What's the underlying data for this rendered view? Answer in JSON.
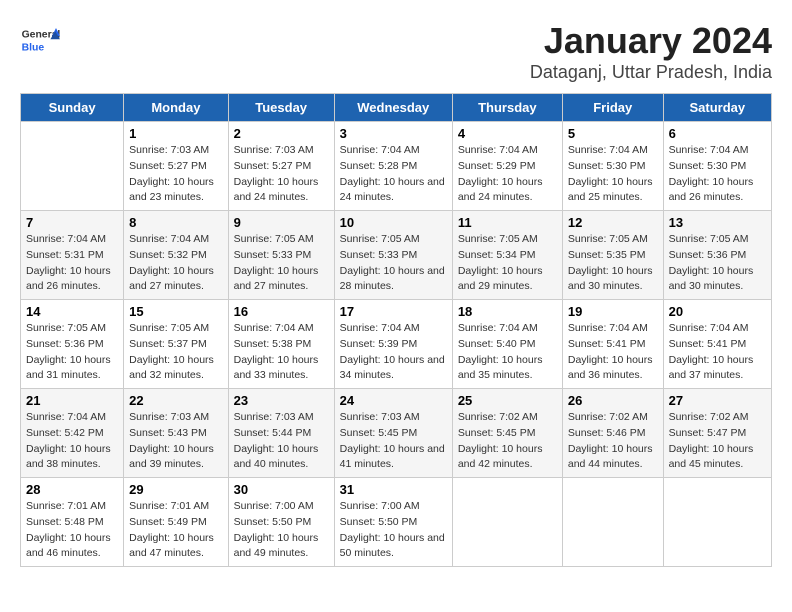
{
  "header": {
    "logo_general": "General",
    "logo_blue": "Blue",
    "title": "January 2024",
    "subtitle": "Dataganj, Uttar Pradesh, India"
  },
  "columns": [
    "Sunday",
    "Monday",
    "Tuesday",
    "Wednesday",
    "Thursday",
    "Friday",
    "Saturday"
  ],
  "weeks": [
    [
      {
        "num": "",
        "sunrise": "",
        "sunset": "",
        "daylight": ""
      },
      {
        "num": "1",
        "sunrise": "7:03 AM",
        "sunset": "5:27 PM",
        "daylight": "10 hours and 23 minutes."
      },
      {
        "num": "2",
        "sunrise": "7:03 AM",
        "sunset": "5:27 PM",
        "daylight": "10 hours and 24 minutes."
      },
      {
        "num": "3",
        "sunrise": "7:04 AM",
        "sunset": "5:28 PM",
        "daylight": "10 hours and 24 minutes."
      },
      {
        "num": "4",
        "sunrise": "7:04 AM",
        "sunset": "5:29 PM",
        "daylight": "10 hours and 24 minutes."
      },
      {
        "num": "5",
        "sunrise": "7:04 AM",
        "sunset": "5:30 PM",
        "daylight": "10 hours and 25 minutes."
      },
      {
        "num": "6",
        "sunrise": "7:04 AM",
        "sunset": "5:30 PM",
        "daylight": "10 hours and 26 minutes."
      }
    ],
    [
      {
        "num": "7",
        "sunrise": "7:04 AM",
        "sunset": "5:31 PM",
        "daylight": "10 hours and 26 minutes."
      },
      {
        "num": "8",
        "sunrise": "7:04 AM",
        "sunset": "5:32 PM",
        "daylight": "10 hours and 27 minutes."
      },
      {
        "num": "9",
        "sunrise": "7:05 AM",
        "sunset": "5:33 PM",
        "daylight": "10 hours and 27 minutes."
      },
      {
        "num": "10",
        "sunrise": "7:05 AM",
        "sunset": "5:33 PM",
        "daylight": "10 hours and 28 minutes."
      },
      {
        "num": "11",
        "sunrise": "7:05 AM",
        "sunset": "5:34 PM",
        "daylight": "10 hours and 29 minutes."
      },
      {
        "num": "12",
        "sunrise": "7:05 AM",
        "sunset": "5:35 PM",
        "daylight": "10 hours and 30 minutes."
      },
      {
        "num": "13",
        "sunrise": "7:05 AM",
        "sunset": "5:36 PM",
        "daylight": "10 hours and 30 minutes."
      }
    ],
    [
      {
        "num": "14",
        "sunrise": "7:05 AM",
        "sunset": "5:36 PM",
        "daylight": "10 hours and 31 minutes."
      },
      {
        "num": "15",
        "sunrise": "7:05 AM",
        "sunset": "5:37 PM",
        "daylight": "10 hours and 32 minutes."
      },
      {
        "num": "16",
        "sunrise": "7:04 AM",
        "sunset": "5:38 PM",
        "daylight": "10 hours and 33 minutes."
      },
      {
        "num": "17",
        "sunrise": "7:04 AM",
        "sunset": "5:39 PM",
        "daylight": "10 hours and 34 minutes."
      },
      {
        "num": "18",
        "sunrise": "7:04 AM",
        "sunset": "5:40 PM",
        "daylight": "10 hours and 35 minutes."
      },
      {
        "num": "19",
        "sunrise": "7:04 AM",
        "sunset": "5:41 PM",
        "daylight": "10 hours and 36 minutes."
      },
      {
        "num": "20",
        "sunrise": "7:04 AM",
        "sunset": "5:41 PM",
        "daylight": "10 hours and 37 minutes."
      }
    ],
    [
      {
        "num": "21",
        "sunrise": "7:04 AM",
        "sunset": "5:42 PM",
        "daylight": "10 hours and 38 minutes."
      },
      {
        "num": "22",
        "sunrise": "7:03 AM",
        "sunset": "5:43 PM",
        "daylight": "10 hours and 39 minutes."
      },
      {
        "num": "23",
        "sunrise": "7:03 AM",
        "sunset": "5:44 PM",
        "daylight": "10 hours and 40 minutes."
      },
      {
        "num": "24",
        "sunrise": "7:03 AM",
        "sunset": "5:45 PM",
        "daylight": "10 hours and 41 minutes."
      },
      {
        "num": "25",
        "sunrise": "7:02 AM",
        "sunset": "5:45 PM",
        "daylight": "10 hours and 42 minutes."
      },
      {
        "num": "26",
        "sunrise": "7:02 AM",
        "sunset": "5:46 PM",
        "daylight": "10 hours and 44 minutes."
      },
      {
        "num": "27",
        "sunrise": "7:02 AM",
        "sunset": "5:47 PM",
        "daylight": "10 hours and 45 minutes."
      }
    ],
    [
      {
        "num": "28",
        "sunrise": "7:01 AM",
        "sunset": "5:48 PM",
        "daylight": "10 hours and 46 minutes."
      },
      {
        "num": "29",
        "sunrise": "7:01 AM",
        "sunset": "5:49 PM",
        "daylight": "10 hours and 47 minutes."
      },
      {
        "num": "30",
        "sunrise": "7:00 AM",
        "sunset": "5:50 PM",
        "daylight": "10 hours and 49 minutes."
      },
      {
        "num": "31",
        "sunrise": "7:00 AM",
        "sunset": "5:50 PM",
        "daylight": "10 hours and 50 minutes."
      },
      {
        "num": "",
        "sunrise": "",
        "sunset": "",
        "daylight": ""
      },
      {
        "num": "",
        "sunrise": "",
        "sunset": "",
        "daylight": ""
      },
      {
        "num": "",
        "sunrise": "",
        "sunset": "",
        "daylight": ""
      }
    ]
  ]
}
